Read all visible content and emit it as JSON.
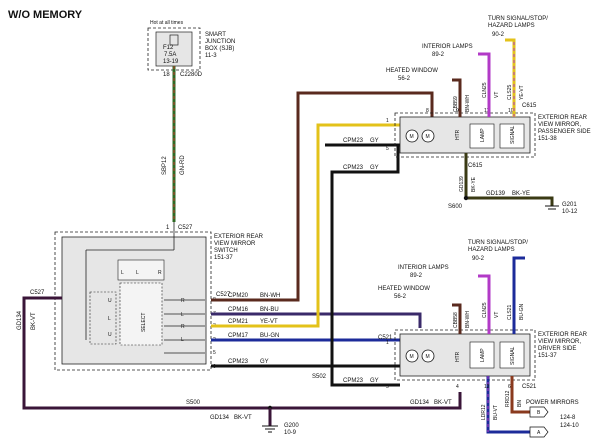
{
  "title": "W/O MEMORY",
  "sjb": {
    "hot_label": "Hot at all times",
    "fuse": "F12",
    "amp": "7.5A",
    "fuse_ref": "13-19",
    "name_1": "SMART",
    "name_2": "JUNCTION",
    "name_3": "BOX (SJB)",
    "ref": "11-3",
    "pin": "18",
    "conn": "C2280D"
  },
  "main_wire": {
    "circuit": "SBP12",
    "color": "GN-RD"
  },
  "switch": {
    "line1": "EXTERIOR REAR",
    "line2": "VIEW MIRROR",
    "line3": "SWITCH",
    "ref": "151-37",
    "conn_top": "C527",
    "pin_top": "1",
    "conn_left": "C527",
    "select_label": "SELECT",
    "pin_labels": {
      "u": "U",
      "l": "L",
      "r": "R"
    }
  },
  "pass_mirror": {
    "line1": "EXTERIOR REAR",
    "line2": "VIEW MIRROR,",
    "line3": "PASSENGER SIDE",
    "ref": "151-38",
    "conn": "C615",
    "conn_bottom": "C615",
    "htr": "HTR",
    "lamp": "LAMP",
    "signal": "SIGNAL",
    "motor": "M"
  },
  "driver_mirror": {
    "line1": "EXTERIOR REAR",
    "line2": "VIEW MIRROR,",
    "line3": "DRIVER SIDE",
    "ref": "151-37",
    "conn": "C521",
    "conn_bottom": "C521",
    "htr": "HTR",
    "lamp": "LAMP",
    "signal": "SIGNAL",
    "motor": "M"
  },
  "pass_refs": {
    "interior": "INTERIOR LAMPS",
    "interior_ref": "89-2",
    "heated": "HEATED WINDOW",
    "heated_ref": "56-2",
    "turn1": "TURN SIGNAL/STOP/",
    "turn2": "HAZARD LAMPS",
    "turn_ref": "90-2"
  },
  "drv_refs": {
    "interior": "INTERIOR LAMPS",
    "interior_ref": "89-2",
    "heated": "HEATED WINDOW",
    "heated_ref": "56-2",
    "turn1": "TURN SIGNAL/STOP/",
    "turn2": "HAZARD LAMPS",
    "turn_ref": "90-2"
  },
  "wires": {
    "cpm20": "CPM20",
    "bn_wh": "BN-WH",
    "cpm16": "CPM16",
    "bn_bu": "BN-BU",
    "cpm21": "CPM21",
    "ye_vt": "YE-VT",
    "cpm17": "CPM17",
    "bu_gn": "BU-GN",
    "cpm23": "CPM23",
    "gy": "GY",
    "gd134": "GD134",
    "bk_vt": "BK-VT",
    "gd139": "GD139",
    "bk_ye": "BK-YE",
    "cbb59": "CBB59",
    "bn_wh2": "BN-WH",
    "cln25": "CLN25",
    "vt": "VT",
    "cls25": "CLS25",
    "ye_vt2": "YE-VT",
    "cbb58": "CBB58",
    "cls21": "CLS21",
    "ldr12": "LDR12",
    "rrd12": "RRD12",
    "bu_vt": "BU-VT",
    "bn": "BN",
    "bu_gn2": "BU-GN"
  },
  "splices": {
    "s500": "S500",
    "s502": "S502",
    "s600": "S600"
  },
  "grounds": {
    "g201": "G201",
    "g201_ref": "10-12",
    "g200": "G200",
    "g200_ref": "10-9"
  },
  "power_mirrors": {
    "label": "POWER MIRRORS",
    "a": "A",
    "b": "B",
    "ref1": "124-8",
    "ref2": "124-10"
  },
  "pins": {
    "p8": "8",
    "p1": "1",
    "p11": "11",
    "p10": "10",
    "p12": "12",
    "p5": "5",
    "p6": "6",
    "p7": "7",
    "p3": "3",
    "p2": "2",
    "p4": "4",
    "p9": "9"
  },
  "colors": {
    "brown": "#5a2a1e",
    "yellow": "#e3c21a",
    "blue": "#1c2b9a",
    "violet": "#b23ac7",
    "green": "#3e7d2a",
    "gray": "#9a9a9a",
    "black": "#111111"
  }
}
